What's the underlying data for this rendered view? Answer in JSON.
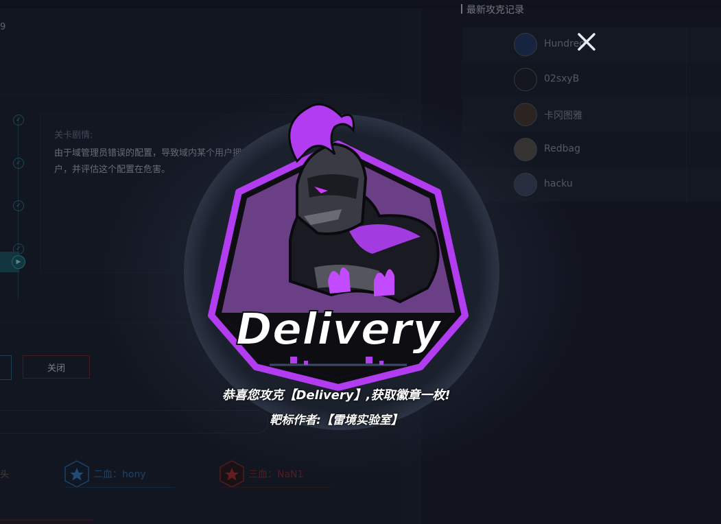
{
  "page": {
    "partial_number": "9",
    "story_title": "关卡剧情:",
    "story_text": "由于域管理员错误的配置，导致域内某个用户拥有 DACL。你的任务是找到该用户，并评估这个配置在危害。",
    "close_button_label": "关闭",
    "first_blood_partial": "头",
    "second_blood": "二血：hony",
    "third_blood": "三血：NaN1"
  },
  "records": {
    "title": "最新攻克记录",
    "items": [
      {
        "name": "Hundred"
      },
      {
        "name": "02sxyB"
      },
      {
        "name": "卡冈图雅"
      },
      {
        "name": "Redbag"
      },
      {
        "name": "hacku"
      }
    ]
  },
  "modal": {
    "badge_name": "Delivery",
    "message_line1": "恭喜您攻克【Delivery】,获取徽章一枚!",
    "message_line2": "靶标作者:【雷境实验室】",
    "colors": {
      "accent_purple": "#b13cf0",
      "dark": "#0d0d12"
    }
  }
}
